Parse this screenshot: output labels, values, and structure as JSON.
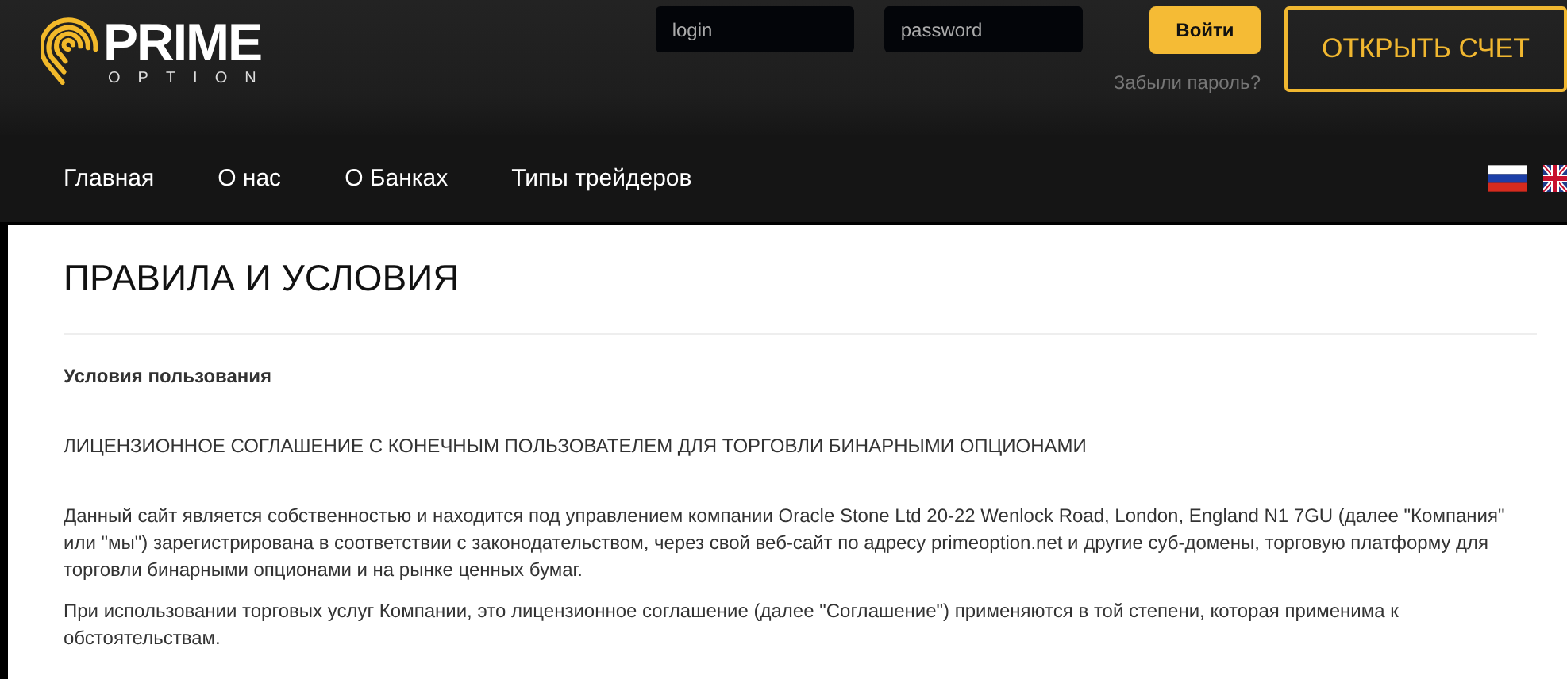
{
  "logo": {
    "name": "PRIME",
    "tagline": "OPTION"
  },
  "login": {
    "login_placeholder": "login",
    "password_placeholder": "password",
    "button": "Войти",
    "forgot": "Забыли пароль?"
  },
  "open_account": "ОТКРЫТЬ СЧЕТ",
  "nav": [
    {
      "label": "Главная"
    },
    {
      "label": "О нас"
    },
    {
      "label": "О Банках"
    },
    {
      "label": "Типы трейдеров"
    }
  ],
  "page": {
    "title": "ПРАВИЛА И УСЛОВИЯ",
    "section": "Условия пользования",
    "heading": "ЛИЦЕНЗИОННОЕ СОГЛАШЕНИЕ С КОНЕЧНЫМ ПОЛЬЗОВАТЕЛЕМ ДЛЯ ТОРГОВЛИ БИНАРНЫМИ ОПЦИОНАМИ",
    "paragraphs": [
      "Данный сайт является собственностью и находится под управлением компании Oracle Stone Ltd 20-22 Wenlock Road, London, England N1 7GU (далее \"Компания\" или \"мы\") зарегистрирована в соответствии с законодательством, через свой веб-сайт по адресу primeoption.net и другие суб-домены, торговую платформу для торговли бинарными опционами и на рынке ценных бумаг.",
      "При использовании торговых услуг Компании, это лицензионное соглашение (далее \"Соглашение\") применяются в той степени, которая применима к обстоятельствам."
    ]
  }
}
